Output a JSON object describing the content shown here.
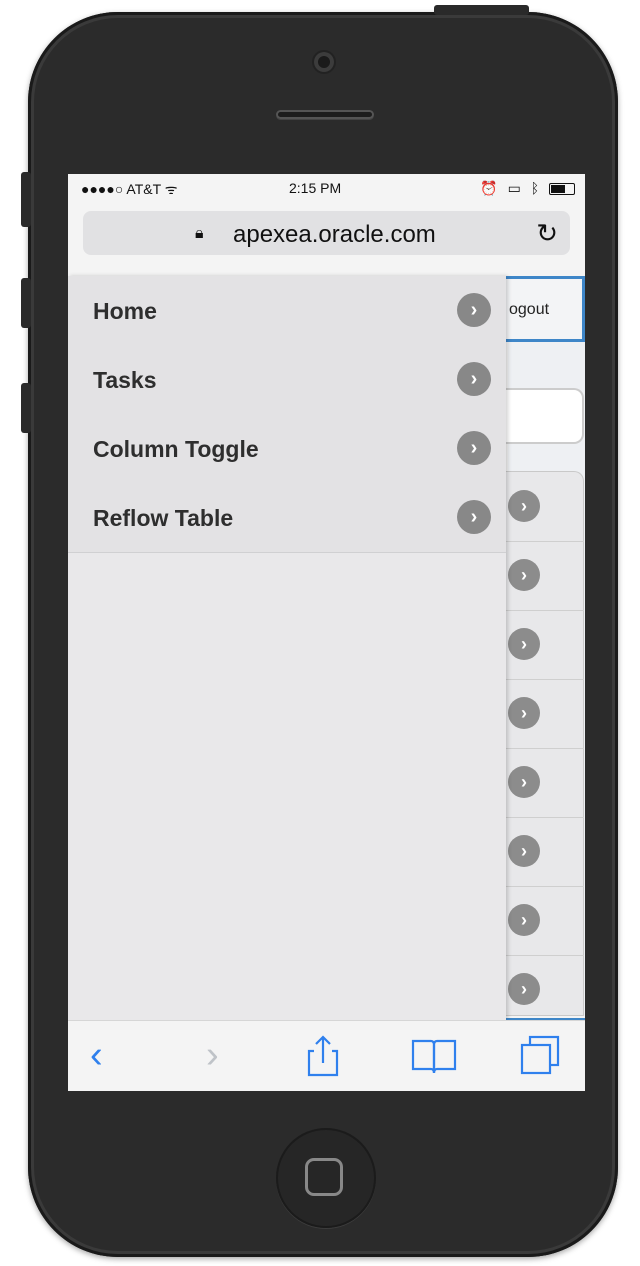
{
  "status_bar": {
    "carrier": "●●●●○ AT&T ᯤ",
    "time": "2:15 PM"
  },
  "browser": {
    "url": "apexea.oracle.com"
  },
  "page": {
    "logout_label": "ogout"
  },
  "side_menu": {
    "items": [
      {
        "label": "Home"
      },
      {
        "label": "Tasks"
      },
      {
        "label": "Column Toggle"
      },
      {
        "label": "Reflow Table"
      }
    ]
  },
  "colors": {
    "accent": "#3e86c8",
    "ios_blue": "#2f80ed"
  }
}
